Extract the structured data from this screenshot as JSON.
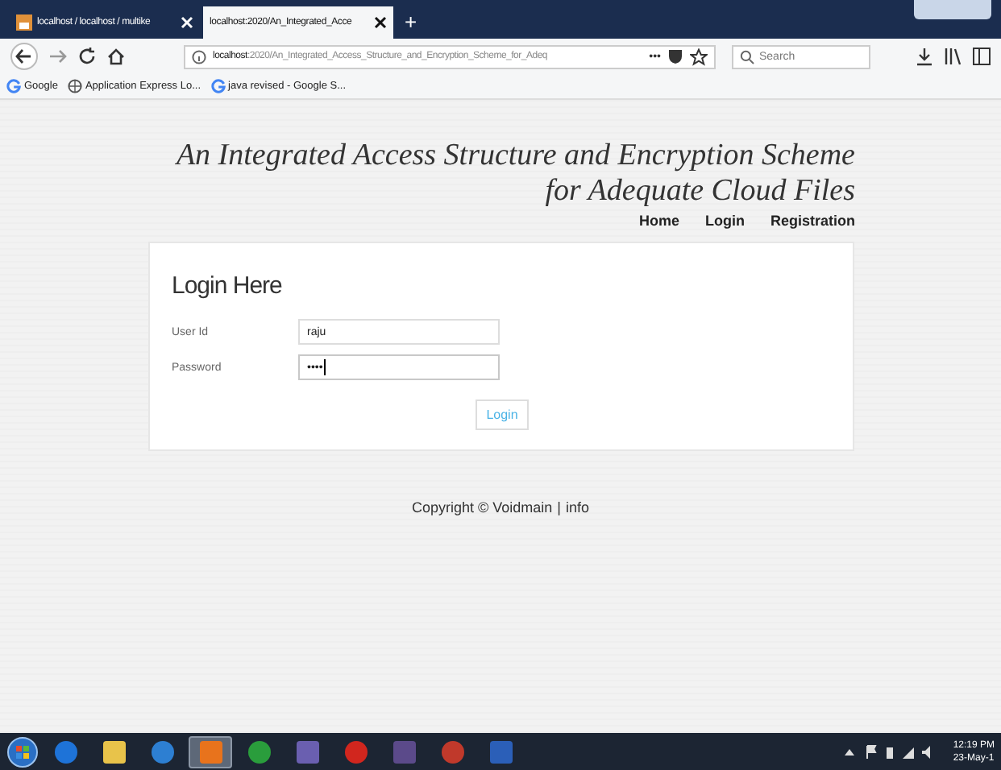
{
  "browser": {
    "tabs": [
      {
        "title": "localhost / localhost / multike",
        "selected": false
      },
      {
        "title": "localhost:2020/An_Integrated_Acce",
        "selected": true
      }
    ],
    "new_tab": "+",
    "address": {
      "host": "localhost",
      "path": ":2020/An_Integrated_Access_Structure_and_Encryption_Scheme_for_Adeq"
    },
    "page_actions": "•••",
    "search": {
      "placeholder": "Search"
    },
    "bookmarks": [
      "Google",
      "Application Express Lo...",
      "java revised - Google S..."
    ]
  },
  "page": {
    "title": "An Integrated Access Structure and Encryption Scheme for Adequate Cloud Files",
    "nav": [
      "Home",
      "Login",
      "Registration"
    ],
    "login": {
      "heading": "Login Here",
      "fields": [
        {
          "label": "User Id",
          "value": "raju",
          "focused": false
        },
        {
          "label": "Password",
          "value": "••••",
          "focused": true
        }
      ],
      "button": "Login"
    },
    "footer": {
      "copyright": "Copyright © Voidmain",
      "separator": "|",
      "link": "info"
    }
  },
  "taskbar": {
    "apps": [
      {
        "selected": false
      },
      {
        "selected": false
      },
      {
        "selected": false
      },
      {
        "selected": true
      },
      {
        "selected": false
      },
      {
        "selected": false
      },
      {
        "selected": false
      },
      {
        "selected": false
      },
      {
        "selected": false
      },
      {
        "selected": false
      }
    ],
    "time": "12:19 PM",
    "date": "23-May-1"
  }
}
